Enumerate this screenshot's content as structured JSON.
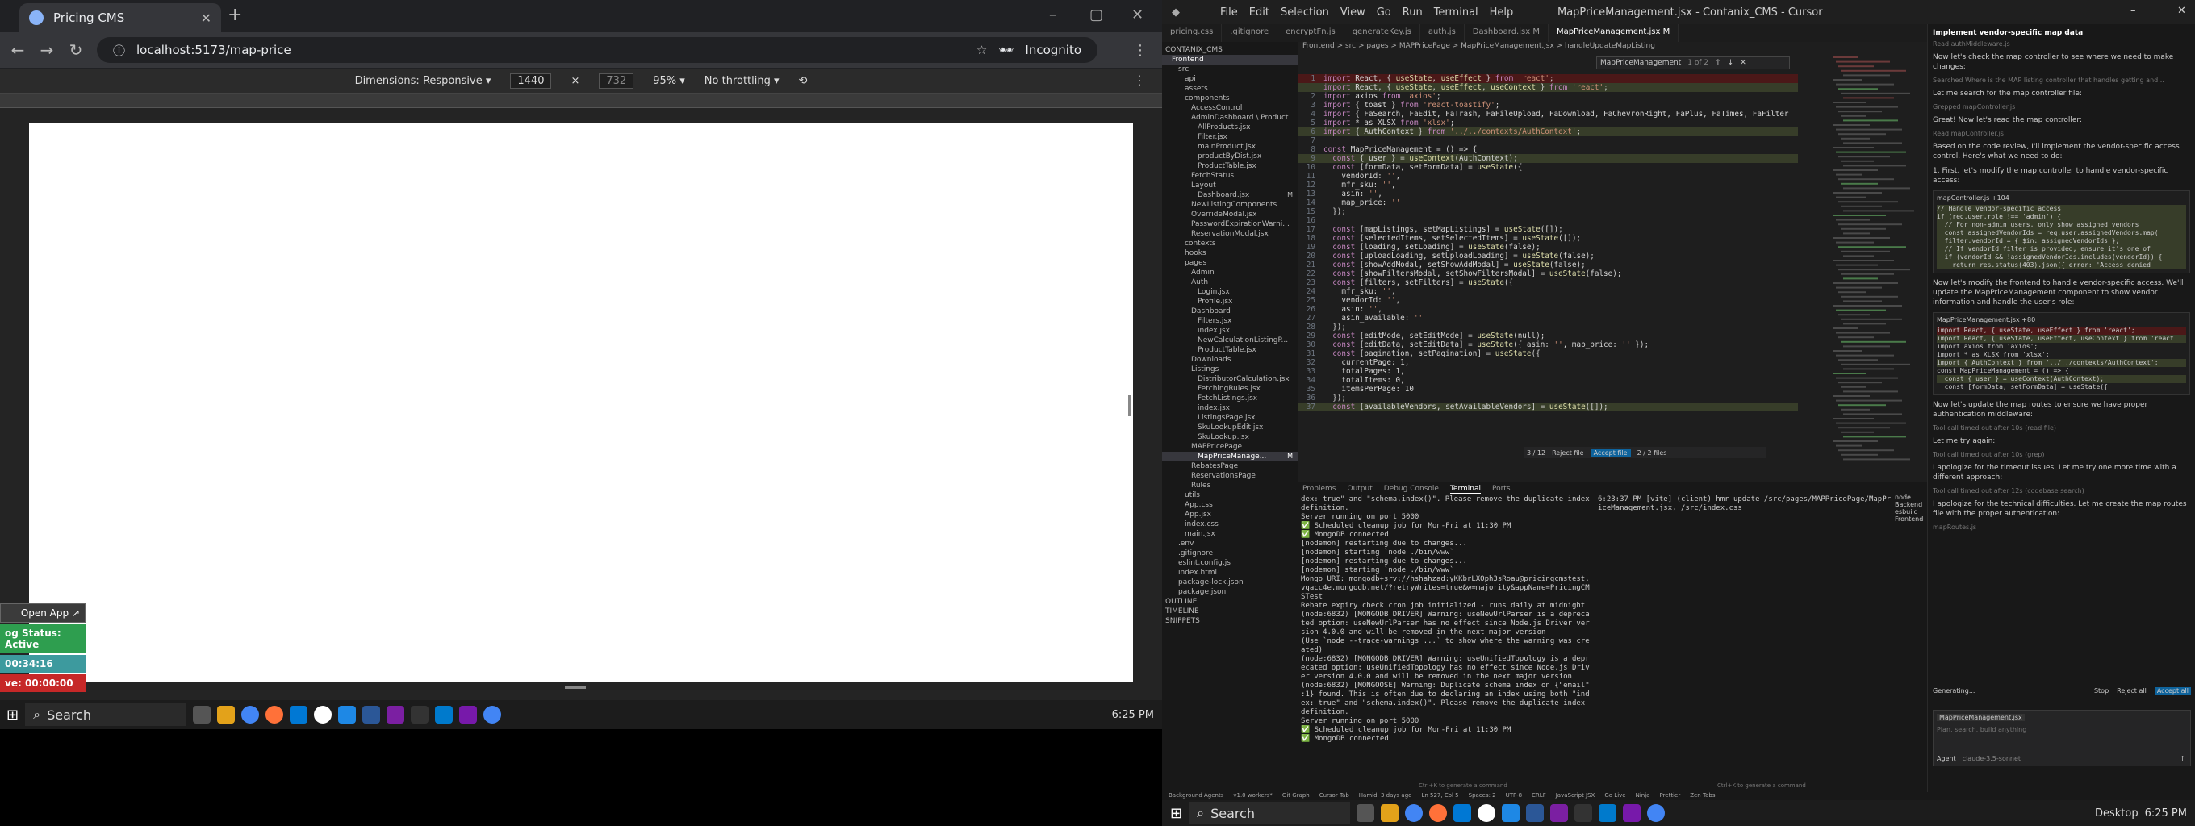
{
  "browser": {
    "tab_title": "Pricing CMS",
    "url": "localhost:5173/map-price",
    "incognito_label": "Incognito",
    "devtools": {
      "dimensions_label": "Dimensions: Responsive",
      "width": "1440",
      "height": "732",
      "zoom": "95%",
      "throttle": "No throttling"
    },
    "widget": {
      "open_app": "Open App",
      "sync_status": "og Status: Active",
      "timer": "00:34:16",
      "ave": "ve: 00:00:00"
    }
  },
  "taskbar_left": {
    "search_label": "Search",
    "time": "6:25 PM"
  },
  "cursor": {
    "menus": [
      "File",
      "Edit",
      "Selection",
      "View",
      "Go",
      "Run",
      "Terminal",
      "Help"
    ],
    "window_title": "MapPriceManagement.jsx - Contanix_CMS - Cursor",
    "editor_tabs": [
      {
        "label": "pricing.css",
        "active": false
      },
      {
        "label": ".gitignore",
        "active": false
      },
      {
        "label": "encryptFn.js",
        "active": false
      },
      {
        "label": "generateKey.js",
        "active": false
      },
      {
        "label": "auth.js",
        "active": false
      },
      {
        "label": "Dashboard.jsx M",
        "active": false
      },
      {
        "label": "MapPriceManagement.jsx M",
        "active": true
      }
    ],
    "breadcrumb": "Frontend > src > pages > MAPPricePage > MapPriceManagement.jsx > handleUpdateMapListing",
    "find_widget": {
      "query": "MapPriceManagement",
      "result": "1 of 2"
    },
    "diff_bar": {
      "counter": "3 / 12",
      "reject_label": "Reject file",
      "accept_label": "Accept file",
      "file_counter": "2 / 2 files"
    },
    "explorer": [
      {
        "label": "CONTANIX_CMS",
        "indent": 0
      },
      {
        "label": "Frontend",
        "indent": 1,
        "sel": true
      },
      {
        "label": "src",
        "indent": 2
      },
      {
        "label": "api",
        "indent": 3
      },
      {
        "label": "assets",
        "indent": 3
      },
      {
        "label": "components",
        "indent": 3
      },
      {
        "label": "AccessControl",
        "indent": 4
      },
      {
        "label": "AdminDashboard \\ Product",
        "indent": 4
      },
      {
        "label": "AllProducts.jsx",
        "indent": 5
      },
      {
        "label": "Filter.jsx",
        "indent": 5
      },
      {
        "label": "mainProduct.jsx",
        "indent": 5
      },
      {
        "label": "productByDist.jsx",
        "indent": 5
      },
      {
        "label": "ProductTable.jsx",
        "indent": 5
      },
      {
        "label": "FetchStatus",
        "indent": 4
      },
      {
        "label": "Layout",
        "indent": 4
      },
      {
        "label": "Dashboard.jsx",
        "indent": 5,
        "badge": "M"
      },
      {
        "label": "NewListingComponents",
        "indent": 4
      },
      {
        "label": "OverrideModal.jsx",
        "indent": 4
      },
      {
        "label": "PasswordExpirationWarni...",
        "indent": 4
      },
      {
        "label": "ReservationModal.jsx",
        "indent": 4
      },
      {
        "label": "contexts",
        "indent": 3
      },
      {
        "label": "hooks",
        "indent": 3
      },
      {
        "label": "pages",
        "indent": 3
      },
      {
        "label": "Admin",
        "indent": 4
      },
      {
        "label": "Auth",
        "indent": 4
      },
      {
        "label": "Login.jsx",
        "indent": 5
      },
      {
        "label": "Profile.jsx",
        "indent": 5
      },
      {
        "label": "Dashboard",
        "indent": 4
      },
      {
        "label": "Filters.jsx",
        "indent": 5
      },
      {
        "label": "index.jsx",
        "indent": 5
      },
      {
        "label": "NewCalculationListingP...",
        "indent": 5
      },
      {
        "label": "ProductTable.jsx",
        "indent": 5
      },
      {
        "label": "Downloads",
        "indent": 4
      },
      {
        "label": "Listings",
        "indent": 4
      },
      {
        "label": "DistributorCalculation.jsx",
        "indent": 5
      },
      {
        "label": "FetchingRules.jsx",
        "indent": 5
      },
      {
        "label": "FetchListings.jsx",
        "indent": 5
      },
      {
        "label": "index.jsx",
        "indent": 5
      },
      {
        "label": "ListingsPage.jsx",
        "indent": 5
      },
      {
        "label": "SkuLookupEdit.jsx",
        "indent": 5
      },
      {
        "label": "SkuLookup.jsx",
        "indent": 5
      },
      {
        "label": "MAPPricePage",
        "indent": 4
      },
      {
        "label": "MapPriceManage...",
        "indent": 5,
        "sel": true,
        "badge": "M"
      },
      {
        "label": "RebatesPage",
        "indent": 4
      },
      {
        "label": "ReservationsPage",
        "indent": 4
      },
      {
        "label": "Rules",
        "indent": 4
      },
      {
        "label": "utils",
        "indent": 3
      },
      {
        "label": "App.css",
        "indent": 3
      },
      {
        "label": "App.jsx",
        "indent": 3
      },
      {
        "label": "index.css",
        "indent": 3
      },
      {
        "label": "main.jsx",
        "indent": 3
      },
      {
        "label": ".env",
        "indent": 2
      },
      {
        "label": ".gitignore",
        "indent": 2
      },
      {
        "label": "eslint.config.js",
        "indent": 2
      },
      {
        "label": "index.html",
        "indent": 2
      },
      {
        "label": "package-lock.json",
        "indent": 2
      },
      {
        "label": "package.json",
        "indent": 2
      },
      {
        "label": "OUTLINE",
        "indent": 0
      },
      {
        "label": "TIMELINE",
        "indent": 0
      },
      {
        "label": "SNIPPETS",
        "indent": 0
      }
    ],
    "code_lines": [
      {
        "n": "1",
        "t": "import React, { useState, useEffect } from 'react';",
        "cls": "del"
      },
      {
        "n": "",
        "t": "import React, { useState, useEffect, useContext } from 'react';",
        "cls": "add"
      },
      {
        "n": "2",
        "t": "import axios from 'axios';",
        "cls": ""
      },
      {
        "n": "3",
        "t": "import { toast } from 'react-toastify';",
        "cls": ""
      },
      {
        "n": "4",
        "t": "import { FaSearch, FaEdit, FaTrash, FaFileUpload, FaDownload, FaChevronRight, FaPlus, FaTimes, FaFilter",
        "cls": ""
      },
      {
        "n": "5",
        "t": "import * as XLSX from 'xlsx';",
        "cls": ""
      },
      {
        "n": "6",
        "t": "import { AuthContext } from '../../contexts/AuthContext';",
        "cls": "add"
      },
      {
        "n": "7",
        "t": "",
        "cls": ""
      },
      {
        "n": "8",
        "t": "const MapPriceManagement = () => {",
        "cls": ""
      },
      {
        "n": "9",
        "t": "  const { user } = useContext(AuthContext);",
        "cls": "add"
      },
      {
        "n": "10",
        "t": "  const [formData, setFormData] = useState({",
        "cls": ""
      },
      {
        "n": "11",
        "t": "    vendorId: '',",
        "cls": ""
      },
      {
        "n": "12",
        "t": "    mfr_sku: '',",
        "cls": ""
      },
      {
        "n": "13",
        "t": "    asin: '',",
        "cls": ""
      },
      {
        "n": "14",
        "t": "    map_price: ''",
        "cls": ""
      },
      {
        "n": "15",
        "t": "  });",
        "cls": ""
      },
      {
        "n": "16",
        "t": "",
        "cls": ""
      },
      {
        "n": "17",
        "t": "  const [mapListings, setMapListings] = useState([]);",
        "cls": ""
      },
      {
        "n": "18",
        "t": "  const [selectedItems, setSelectedItems] = useState([]);",
        "cls": ""
      },
      {
        "n": "19",
        "t": "  const [loading, setLoading] = useState(false);",
        "cls": ""
      },
      {
        "n": "20",
        "t": "  const [uploadLoading, setUploadLoading] = useState(false);",
        "cls": ""
      },
      {
        "n": "21",
        "t": "  const [showAddModal, setShowAddModal] = useState(false);",
        "cls": ""
      },
      {
        "n": "22",
        "t": "  const [showFiltersModal, setShowFiltersModal] = useState(false);",
        "cls": ""
      },
      {
        "n": "23",
        "t": "  const [filters, setFilters] = useState({",
        "cls": ""
      },
      {
        "n": "24",
        "t": "    mfr_sku: '',",
        "cls": ""
      },
      {
        "n": "25",
        "t": "    vendorId: '',",
        "cls": ""
      },
      {
        "n": "26",
        "t": "    asin: '',",
        "cls": ""
      },
      {
        "n": "27",
        "t": "    asin_available: ''",
        "cls": ""
      },
      {
        "n": "28",
        "t": "  });",
        "cls": ""
      },
      {
        "n": "29",
        "t": "  const [editMode, setEditMode] = useState(null);",
        "cls": ""
      },
      {
        "n": "30",
        "t": "  const [editData, setEditData] = useState({ asin: '', map_price: '' });",
        "cls": ""
      },
      {
        "n": "31",
        "t": "  const [pagination, setPagination] = useState({",
        "cls": ""
      },
      {
        "n": "32",
        "t": "    currentPage: 1,",
        "cls": ""
      },
      {
        "n": "33",
        "t": "    totalPages: 1,",
        "cls": ""
      },
      {
        "n": "34",
        "t": "    totalItems: 0,",
        "cls": ""
      },
      {
        "n": "35",
        "t": "    itemsPerPage: 10",
        "cls": ""
      },
      {
        "n": "36",
        "t": "  });",
        "cls": ""
      },
      {
        "n": "37",
        "t": "  const [availableVendors, setAvailableVendors] = useState([]);",
        "cls": "add"
      }
    ],
    "panel_tabs": [
      "Problems",
      "Output",
      "Debug Console",
      "Terminal",
      "Ports"
    ],
    "terminal_left": [
      "dex: true\" and \"schema.index()\". Please remove the duplicate index",
      " definition.",
      "Server running on port 5000",
      "✅ Scheduled cleanup job for Mon-Fri at 11:30 PM",
      "✅ MongoDB connected",
      "[nodemon] restarting due to changes...",
      "[nodemon] starting `node ./bin/www`",
      "[nodemon] restarting due to changes...",
      "[nodemon] starting `node ./bin/www`",
      "Mongo URI: mongodb+srv://hshahzad:yKKbrLXOph3sRoau@pricingcmstest.",
      "vqacc4e.mongodb.net/?retryWrites=true&w=majority&appName=PricingCM",
      "STest",
      "Rebate expiry check cron job initialized - runs daily at midnight",
      "(node:6832) [MONGODB DRIVER] Warning: useNewUrlParser is a depreca",
      "ted option: useNewUrlParser has no effect since Node.js Driver ver",
      "sion 4.0.0 and will be removed in the next major version",
      "(Use `node --trace-warnings ...` to show where the warning was cre",
      "ated)",
      "(node:6832) [MONGODB DRIVER] Warning: useUnifiedTopology is a depr",
      "ecated option: useUnifiedTopology has no effect since Node.js Driv",
      "er version 4.0.0 and will be removed in the next major version",
      "(node:6832) [MONGOOSE] Warning: Duplicate schema index on {\"email\"",
      ":1} found. This is often due to declaring an index using both \"ind",
      "ex: true\" and \"schema.index()\". Please remove the duplicate index",
      " definition.",
      "Server running on port 5000",
      "✅ Scheduled cleanup job for Mon-Fri at 11:30 PM",
      "✅ MongoDB connected"
    ],
    "terminal_right": [
      "6:23:37 PM [vite] (client) hmr update /src/pages/MAPPricePage/MapPr",
      "iceManagement.jsx, /src/index.css"
    ],
    "terminal_list": [
      "node Backend",
      "esbuild Frontend"
    ],
    "terminal_hint_left": "Ctrl+K to generate a command",
    "terminal_hint_right": "Ctrl+K to generate a command",
    "chat": {
      "title": "Implement vendor-specific map data",
      "messages": [
        {
          "kind": "muted",
          "text": "Read authMiddleware.js"
        },
        {
          "kind": "msg",
          "text": "Now let's check the map controller to see where we need to make changes:"
        },
        {
          "kind": "muted",
          "text": "Searched Where is the MAP listing controller that handles getting and..."
        },
        {
          "kind": "msg",
          "text": "Let me search for the map controller file:"
        },
        {
          "kind": "muted",
          "text": "Grepped mapController.js"
        },
        {
          "kind": "msg",
          "text": "Great! Now let's read the map controller:"
        },
        {
          "kind": "muted",
          "text": "Read mapController.js"
        },
        {
          "kind": "msg",
          "text": "Based on the code review, I'll implement the vendor-specific access control. Here's what we need to do:"
        },
        {
          "kind": "msg",
          "text": "1. First, let's modify the map controller to handle vendor-specific access:"
        }
      ],
      "card1": {
        "header": "mapController.js +104",
        "lines": [
          "// Handle vendor-specific access",
          "if (req.user.role !== 'admin') {",
          "  // For non-admin users, only show assigned vendors",
          "  const assignedVendorIds = req.user.assignedVendors.map(",
          "  filter.vendorId = { $in: assignedVendorIds };",
          "",
          "  // If vendorId filter is provided, ensure it's one of",
          "  if (vendorId && !assignedVendorIds.includes(vendorId)) {",
          "    return res.status(403).json({ error: 'Access denied"
        ]
      },
      "messages2": [
        {
          "kind": "msg",
          "text": "Now let's modify the frontend to handle vendor-specific access. We'll update the MapPriceManagement component to show vendor information and handle the user's role:"
        }
      ],
      "card2": {
        "header": "MapPriceManagement.jsx +80",
        "lines": [
          "import React, { useState, useEffect } from 'react';",
          "import React, { useState, useEffect, useContext } from 'react",
          "import axios from 'axios';",
          "import * as XLSX from 'xlsx';",
          "import { AuthContext } from '../../contexts/AuthContext';",
          "",
          "const MapPriceManagement = () => {",
          "  const { user } = useContext(AuthContext);",
          "  const [formData, setFormData] = useState({"
        ]
      },
      "messages3": [
        {
          "kind": "msg",
          "text": "Now let's update the map routes to ensure we have proper authentication middleware:"
        },
        {
          "kind": "muted",
          "text": "Tool call timed out after 10s (read file)"
        },
        {
          "kind": "msg",
          "text": "Let me try again:"
        },
        {
          "kind": "muted",
          "text": "Tool call timed out after 10s (grep)"
        },
        {
          "kind": "msg",
          "text": "I apologize for the timeout issues. Let me try one more time with a different approach:"
        },
        {
          "kind": "muted",
          "text": "Tool call timed out after 12s (codebase search)"
        },
        {
          "kind": "msg",
          "text": "I apologize for the technical difficulties. Let me create the map routes file with the proper authentication:"
        },
        {
          "kind": "muted",
          "text": "mapRoutes.js"
        }
      ],
      "generating": "Generating...",
      "stop_label": "Stop",
      "reject_all": "Reject all",
      "accept_all": "Accept all",
      "context_file": "MapPriceManagement.jsx",
      "input_placeholder": "Plan, search, build anything",
      "agent_label": "Agent",
      "model_label": "claude-3.5-sonnet"
    },
    "status_items": [
      "Background Agents",
      "v1.0 workers*",
      "Git Graph",
      "Cursor Tab",
      "Hamid, 3 days ago",
      "Ln 527, Col 5",
      "Spaces: 2",
      "UTF-8",
      "CRLF",
      "JavaScript JSX",
      "Go Live",
      "Ninja",
      "Prettier",
      "Zen Tabs"
    ]
  },
  "taskbar_right": {
    "search_label": "Search",
    "desktop_label": "Desktop",
    "time": "6:25 PM"
  },
  "colors": {
    "accent": "#0078d4",
    "diff_removed": "#4b1818",
    "diff_added": "#373d29",
    "active_green": "#2e9e4f",
    "timer_teal": "#3d9a9e",
    "red": "#c62828"
  }
}
